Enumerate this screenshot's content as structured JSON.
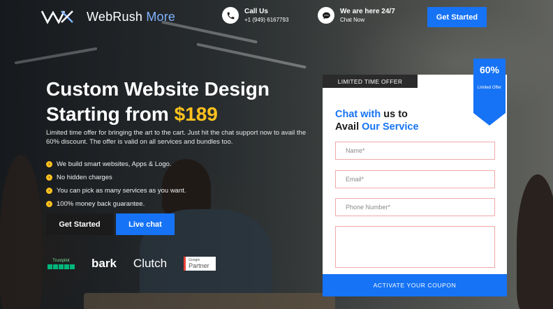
{
  "brand": {
    "name": "WebRush",
    "suffix": "More"
  },
  "header": {
    "call": {
      "title": "Call Us",
      "phone": "+1 (949) 6167793",
      "icon": "phone-icon"
    },
    "chat": {
      "title": "We are here 24/7",
      "subtitle": "Chat Now",
      "icon": "chat-bubble-icon"
    },
    "cta_label": "Get Started"
  },
  "hero": {
    "title_line1": "Custom Website Design",
    "title_line2_prefix": "Starting from",
    "price": "$189",
    "description": "Limited time offer for bringing the art to the cart. Just hit the chat support now to avail the 60% discount. The offer is valid on all services and bundles too.",
    "features": [
      "We build smart websites, Apps & Logo.",
      "No hidden charges",
      "You can pick as many services as you want.",
      "100% money back guarantee."
    ],
    "primary_cta": "Get Started",
    "secondary_cta": "Live chat"
  },
  "partners": {
    "trustpilot": "Trustpilot",
    "bark": "bark",
    "clutch": "Clutch",
    "google_small": "Google",
    "google_big": "Partner"
  },
  "form": {
    "tag": "LIMITED TIME OFFER",
    "ribbon_percent": "60%",
    "ribbon_text": "Limited Offer",
    "heading_blue1": "Chat with",
    "heading_dark1": "us to",
    "heading_dark2": "Avail",
    "heading_blue2": "Our Service",
    "name_placeholder": "Name*",
    "email_placeholder": "Email*",
    "phone_placeholder": "Phone Number*",
    "message_placeholder": "",
    "submit_label": "ACTIVATE YOUR COUPON"
  },
  "colors": {
    "accent": "#1673f5",
    "price": "#ffc21f",
    "dark_button": "#1b1b1b"
  }
}
